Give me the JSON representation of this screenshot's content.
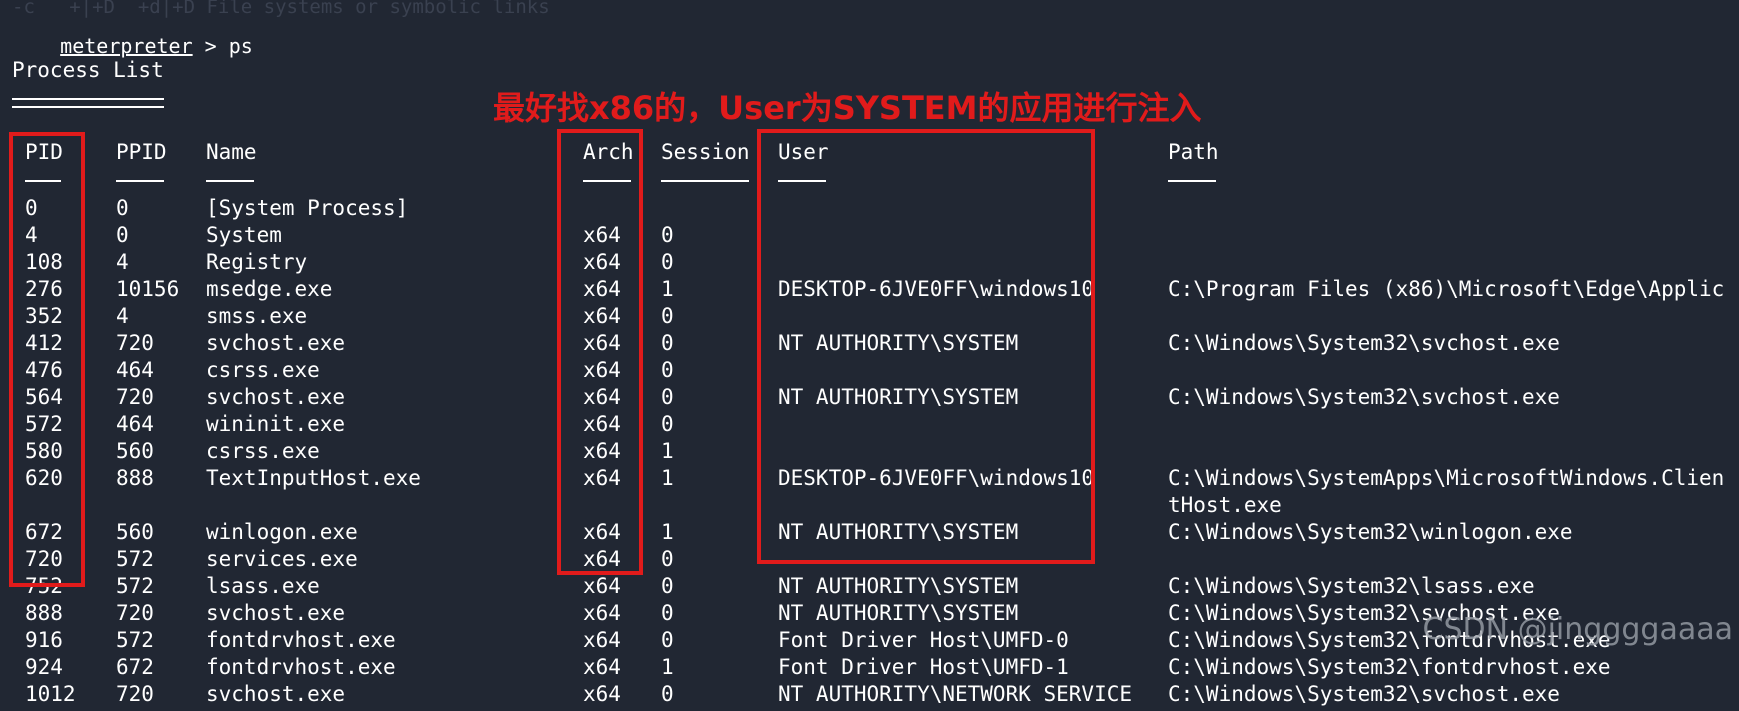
{
  "prompt": {
    "user": "meterpreter",
    "sep": " > ",
    "command": "ps"
  },
  "title": "Process List",
  "headers": {
    "pid": "PID",
    "ppid": "PPID",
    "name": "Name",
    "arch": "Arch",
    "session": "Session",
    "user": "User",
    "path": "Path"
  },
  "annotation": "最好找x86的，User为SYSTEM的应用进行注入",
  "watermark": "CSDN @jinggggaaaa",
  "rows": [
    {
      "pid": "0",
      "ppid": "0",
      "name": "[System Process]",
      "arch": "",
      "session": "",
      "user": "",
      "path": ""
    },
    {
      "pid": "4",
      "ppid": "0",
      "name": "System",
      "arch": "x64",
      "session": "0",
      "user": "",
      "path": ""
    },
    {
      "pid": "108",
      "ppid": "4",
      "name": "Registry",
      "arch": "x64",
      "session": "0",
      "user": "",
      "path": ""
    },
    {
      "pid": "276",
      "ppid": "10156",
      "name": "msedge.exe",
      "arch": "x64",
      "session": "1",
      "user": "DESKTOP-6JVE0FF\\windows10",
      "path": "C:\\Program Files (x86)\\Microsoft\\Edge\\Applic"
    },
    {
      "pid": "352",
      "ppid": "4",
      "name": "smss.exe",
      "arch": "x64",
      "session": "0",
      "user": "",
      "path": ""
    },
    {
      "pid": "412",
      "ppid": "720",
      "name": "svchost.exe",
      "arch": "x64",
      "session": "0",
      "user": "NT AUTHORITY\\SYSTEM",
      "path": "C:\\Windows\\System32\\svchost.exe"
    },
    {
      "pid": "476",
      "ppid": "464",
      "name": "csrss.exe",
      "arch": "x64",
      "session": "0",
      "user": "",
      "path": ""
    },
    {
      "pid": "564",
      "ppid": "720",
      "name": "svchost.exe",
      "arch": "x64",
      "session": "0",
      "user": "NT AUTHORITY\\SYSTEM",
      "path": "C:\\Windows\\System32\\svchost.exe"
    },
    {
      "pid": "572",
      "ppid": "464",
      "name": "wininit.exe",
      "arch": "x64",
      "session": "0",
      "user": "",
      "path": ""
    },
    {
      "pid": "580",
      "ppid": "560",
      "name": "csrss.exe",
      "arch": "x64",
      "session": "1",
      "user": "",
      "path": ""
    },
    {
      "pid": "620",
      "ppid": "888",
      "name": "TextInputHost.exe",
      "arch": "x64",
      "session": "1",
      "user": "DESKTOP-6JVE0FF\\windows10",
      "path": "C:\\Windows\\SystemApps\\MicrosoftWindows.Clien",
      "path2": "tHost.exe"
    },
    {
      "pid": "672",
      "ppid": "560",
      "name": "winlogon.exe",
      "arch": "x64",
      "session": "1",
      "user": "NT AUTHORITY\\SYSTEM",
      "path": "C:\\Windows\\System32\\winlogon.exe"
    },
    {
      "pid": "720",
      "ppid": "572",
      "name": "services.exe",
      "arch": "x64",
      "session": "0",
      "user": "",
      "path": ""
    },
    {
      "pid": "752",
      "ppid": "572",
      "name": "lsass.exe",
      "arch": "x64",
      "session": "0",
      "user": "NT AUTHORITY\\SYSTEM",
      "path": "C:\\Windows\\System32\\lsass.exe"
    },
    {
      "pid": "888",
      "ppid": "720",
      "name": "svchost.exe",
      "arch": "x64",
      "session": "0",
      "user": "NT AUTHORITY\\SYSTEM",
      "path": "C:\\Windows\\System32\\svchost.exe"
    },
    {
      "pid": "916",
      "ppid": "572",
      "name": "fontdrvhost.exe",
      "arch": "x64",
      "session": "0",
      "user": "Font Driver Host\\UMFD-0",
      "path": "C:\\Windows\\System32\\fontdrvhost.exe"
    },
    {
      "pid": "924",
      "ppid": "672",
      "name": "fontdrvhost.exe",
      "arch": "x64",
      "session": "1",
      "user": "Font Driver Host\\UMFD-1",
      "path": "C:\\Windows\\System32\\fontdrvhost.exe"
    },
    {
      "pid": "1012",
      "ppid": "720",
      "name": "svchost.exe",
      "arch": "x64",
      "session": "0",
      "user": "NT AUTHORITY\\NETWORK SERVICE",
      "path": "C:\\Windows\\System32\\svchost.exe"
    }
  ]
}
